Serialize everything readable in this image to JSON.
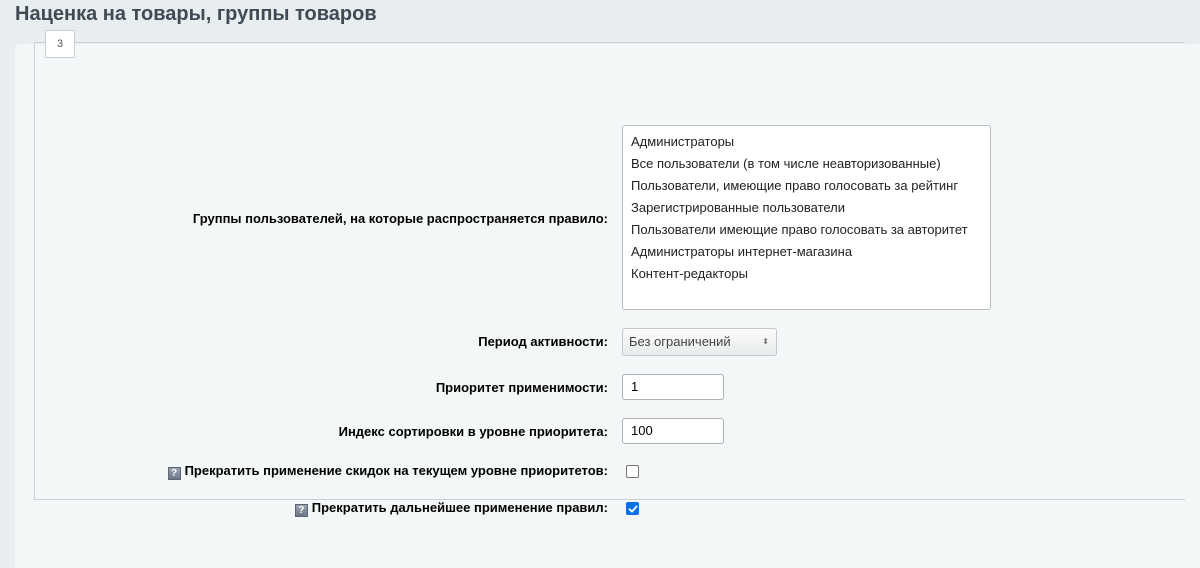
{
  "page": {
    "title": "Наценка на товары, группы товаров"
  },
  "tab_legend": "3",
  "form": {
    "user_groups": {
      "label": "Группы пользователей, на которые распространяется правило:",
      "options": [
        "Администраторы",
        "Все пользователи (в том числе неавторизованные)",
        "Пользователи, имеющие право голосовать за рейтинг",
        "Зарегистрированные пользователи",
        "Пользователи имеющие право голосовать за авторитет",
        "Администраторы интернет-магазина",
        "Контент-редакторы"
      ]
    },
    "activity_period": {
      "label": "Период активности:",
      "value": "Без ограничений"
    },
    "priority": {
      "label": "Приоритет применимости:",
      "value": "1"
    },
    "sort_index": {
      "label": "Индекс сортировки в уровне приоритета:",
      "value": "100"
    },
    "stop_discounts_level": {
      "label": "Прекратить применение скидок на текущем уровне приоритетов:",
      "checked": false
    },
    "stop_further_rules": {
      "label": "Прекратить дальнейшее применение правил:",
      "checked": true
    }
  },
  "colors": {
    "checkbox_checked": "#0a6fe8",
    "title": "#3f4b54"
  },
  "icons": {
    "help": "help-icon",
    "select_arrow": "up-down-arrows-icon"
  }
}
